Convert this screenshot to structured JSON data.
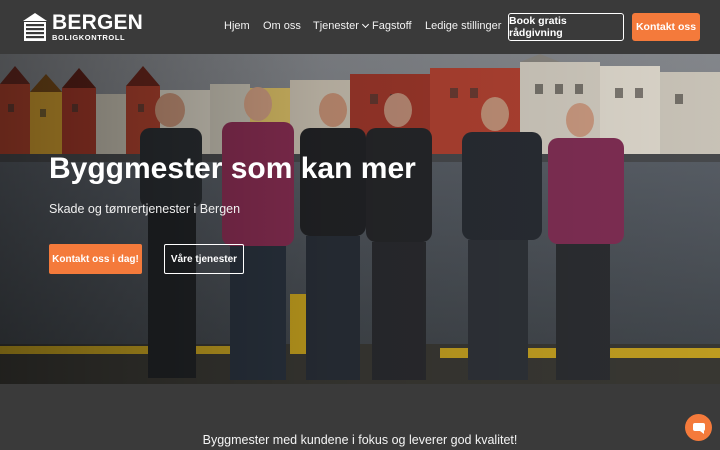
{
  "header": {
    "logo_main": "BERGEN",
    "logo_sub": "BOLIGKONTROLL",
    "nav": [
      "Hjem",
      "Om oss",
      "Tjenester",
      "Fagstoff",
      "Ledige stillinger"
    ],
    "book_button": "Book gratis rådgivning",
    "contact_button": "Kontakt oss"
  },
  "hero": {
    "title": "Byggmester som kan mer",
    "subtitle": "Skade og tømrertjenester i Bergen",
    "primary_button": "Kontakt oss i dag!",
    "secondary_button": "Våre tjenester"
  },
  "tagline": "Byggmester med kundene i fokus og leverer god kvalitet!",
  "icons": [
    "logo-house-icon",
    "chevron-down-icon",
    "chat-icon"
  ],
  "colors": {
    "accent": "#f47a3b",
    "header_bg": "#3a3a3a"
  }
}
